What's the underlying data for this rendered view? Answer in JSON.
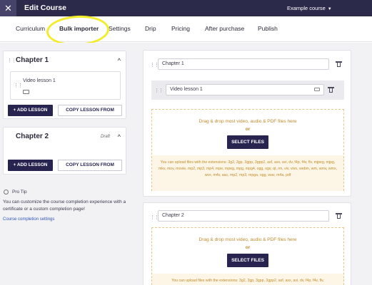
{
  "topbar": {
    "close_label": "✕",
    "title": "Edit Course",
    "course_selector": "Example course",
    "caret": "▼"
  },
  "tabs": [
    {
      "label": "Curriculum"
    },
    {
      "label": "Bulk importer"
    },
    {
      "label": "Settings"
    },
    {
      "label": "Drip"
    },
    {
      "label": "Pricing"
    },
    {
      "label": "After purchase"
    },
    {
      "label": "Publish"
    }
  ],
  "sidebar": {
    "chapters": [
      {
        "title": "Chapter 1",
        "chevron": "^",
        "lesson": "Video lesson 1",
        "add_lesson": "+ ADD LESSON",
        "copy_lesson": "COPY LESSON FROM"
      },
      {
        "title": "Chapter 2",
        "chevron": "^",
        "status": "Draft",
        "add_lesson": "+ ADD LESSON",
        "copy_lesson": "COPY LESSON FROM"
      }
    ],
    "protip": {
      "title": "Pro Tip",
      "text": "You can customize the course completion experience with a certificate or a custom completion page!",
      "link": "Course completion settings"
    }
  },
  "editor": {
    "chapters": [
      {
        "title_value": "Chapter 1",
        "lesson_value": "Video lesson 1",
        "dropzone_title": "Drag & drop most video, audio & PDF files here",
        "dropzone_or": "or",
        "select_files": "SELECT FILES",
        "extensions_text": "You can upload files with the extensions: 3g2, 3gp, 3gpp, 3gpp2, asf, asx, avi, dv, f4p, f4v, flv, mjpeg, mjpg, mkv, mov, movie, mp2, mp3, mp4, mpe, mpeg, mpg, mpg4, ogg, ogv, qt, rm, viv, vivo, webm, wm, wmv, wmx, wvx, m4v, aac, mp2, mp3, mpga, ogg, wav, m4a, pdf"
      },
      {
        "title_value": "Chapter 2",
        "dropzone_title": "Drag & drop most video, audio & PDF files here",
        "dropzone_or": "or",
        "select_files": "SELECT FILES",
        "extensions_text": "You can upload files with the extensions: 3g2, 3gp, 3gpp, 3gpp2, asf, asx, avi, dv, f4p, f4v, flv,"
      }
    ]
  },
  "colors": {
    "topbar": "#2c2a4a",
    "primary_button": "#272450",
    "dropzone_text": "#c08a2a",
    "highlight": "#f2ec2b"
  }
}
